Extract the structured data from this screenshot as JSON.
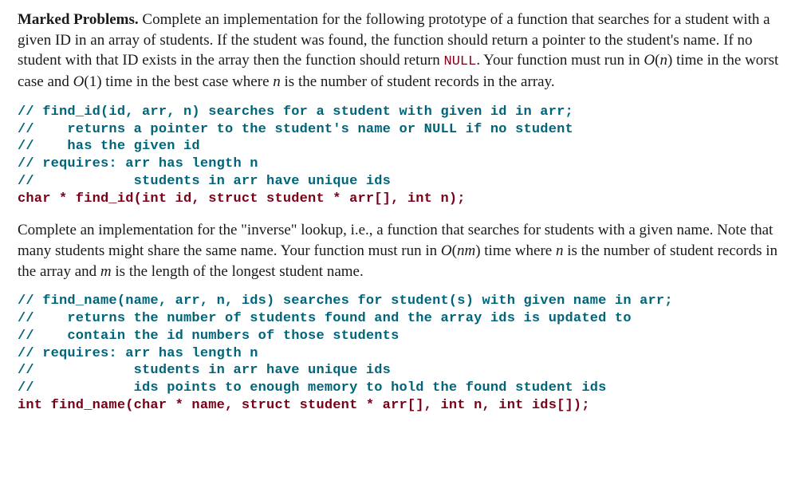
{
  "problem1": {
    "heading": "Marked Problems.",
    "body_before_null": " Complete an implementation for the following prototype of a function that searches for a student with a given ID in an array of students. If the student was found, the function should return a pointer to the student's name. If no student with that ID exists in the array then the function should return ",
    "null_token": "NULL",
    "body_after_null_a": ". Your function must run in ",
    "bigO1": "O",
    "paren1a": "(",
    "n1": "n",
    "paren1b": ")",
    "body_after_null_b": " time in the worst case and ",
    "bigO2": "O",
    "paren2": "(1)",
    "body_after_null_c": " time in the best case where ",
    "n2": "n",
    "body_after_null_d": " is the number of student records in the array."
  },
  "code1": {
    "c1": "// find_id(id, arr, n) searches for a student with given id in arr;",
    "c2": "//    returns a pointer to the student's name or NULL if no student",
    "c3": "//    has the given id",
    "c4": "// requires: arr has length n",
    "c5": "//            students in arr have unique ids",
    "sig": "char * find_id(int id, struct student * arr[], int n);"
  },
  "problem2": {
    "body_a": "Complete an implementation for the \"inverse\" lookup, i.e., a function that searches for students with a given name. Note that many students might share the same name. Your function must run in ",
    "bigO": "O",
    "paren_a": "(",
    "nm": "nm",
    "paren_b": ")",
    "body_b": " time where ",
    "n": "n",
    "body_c": " is the number of student records in the array and ",
    "m": "m",
    "body_d": " is the length of the longest student name."
  },
  "code2": {
    "c1": "// find_name(name, arr, n, ids) searches for student(s) with given name in arr;",
    "c2": "//    returns the number of students found and the array ids is updated to",
    "c3": "//    contain the id numbers of those students",
    "c4": "// requires: arr has length n",
    "c5": "//            students in arr have unique ids",
    "c6": "//            ids points to enough memory to hold the found student ids",
    "sig": "int find_name(char * name, struct student * arr[], int n, int ids[]);"
  }
}
